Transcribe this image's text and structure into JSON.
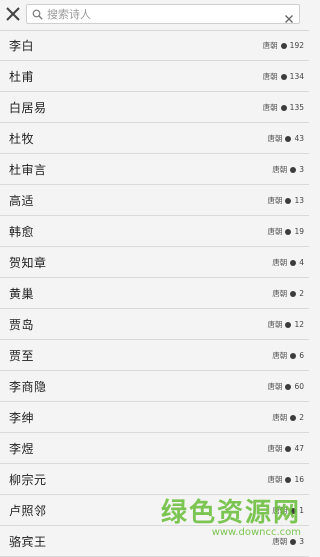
{
  "search": {
    "placeholder": "搜索诗人",
    "value": ""
  },
  "poets": [
    {
      "name": "李白",
      "dynasty": "唐朝",
      "count": "192"
    },
    {
      "name": "杜甫",
      "dynasty": "唐朝",
      "count": "134"
    },
    {
      "name": "白居易",
      "dynasty": "唐朝",
      "count": "135"
    },
    {
      "name": "杜牧",
      "dynasty": "唐朝",
      "count": "43"
    },
    {
      "name": "杜审言",
      "dynasty": "唐朝",
      "count": "3"
    },
    {
      "name": "高适",
      "dynasty": "唐朝",
      "count": "13"
    },
    {
      "name": "韩愈",
      "dynasty": "唐朝",
      "count": "19"
    },
    {
      "name": "贺知章",
      "dynasty": "唐朝",
      "count": "4"
    },
    {
      "name": "黄巢",
      "dynasty": "唐朝",
      "count": "2"
    },
    {
      "name": "贾岛",
      "dynasty": "唐朝",
      "count": "12"
    },
    {
      "name": "贾至",
      "dynasty": "唐朝",
      "count": "6"
    },
    {
      "name": "李商隐",
      "dynasty": "唐朝",
      "count": "60"
    },
    {
      "name": "李绅",
      "dynasty": "唐朝",
      "count": "2"
    },
    {
      "name": "李煜",
      "dynasty": "唐朝",
      "count": "47"
    },
    {
      "name": "柳宗元",
      "dynasty": "唐朝",
      "count": "16"
    },
    {
      "name": "卢照邻",
      "dynasty": "唐朝",
      "count": "1"
    },
    {
      "name": "骆宾王",
      "dynasty": "唐朝",
      "count": "3"
    }
  ],
  "watermark": {
    "main": "绿色资源网",
    "url": "www.downcc.com"
  },
  "colors": {
    "background": "#f4f4f4",
    "divider": "#dadada",
    "watermark": "#6cbf3d"
  },
  "icons": {
    "close": "close-icon",
    "search": "search-icon",
    "clear": "clear-icon",
    "dot": "dot-icon"
  }
}
